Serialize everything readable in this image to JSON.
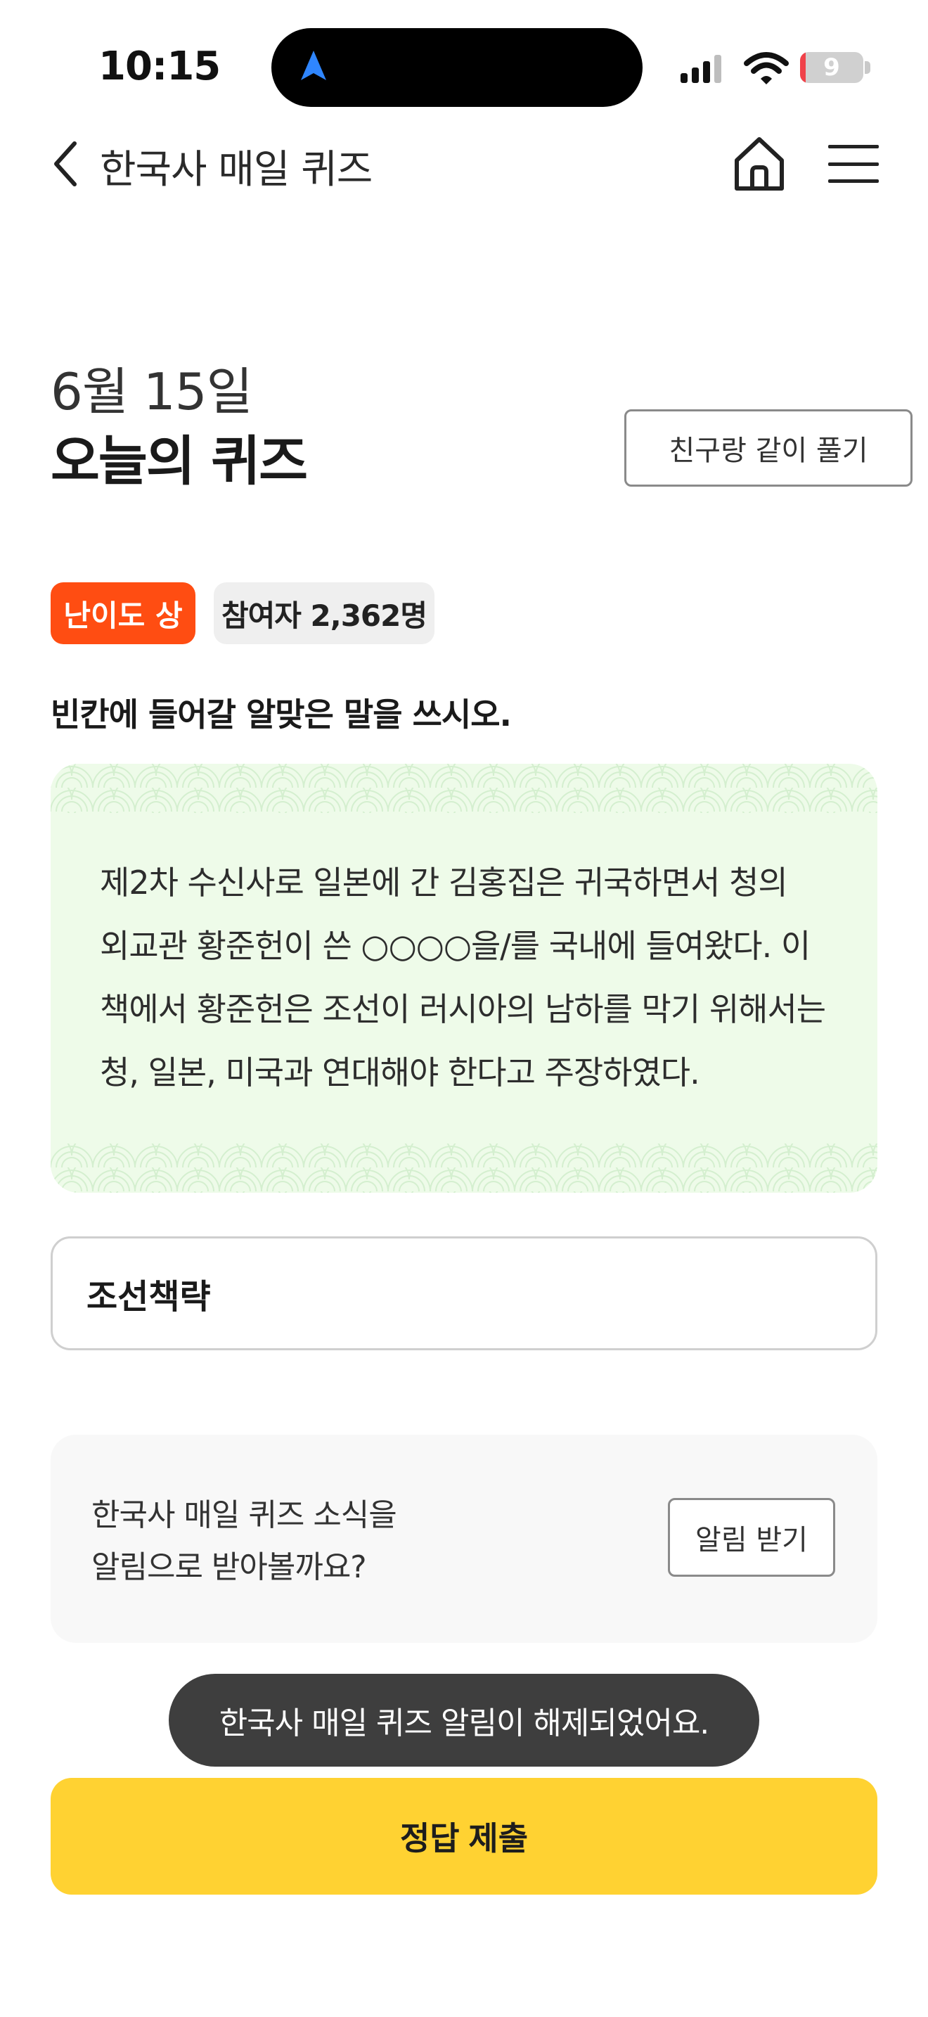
{
  "status_bar": {
    "time": "10:15",
    "battery_level": "9",
    "battery_fraction": 0.09
  },
  "nav": {
    "title": "한국사 매일 퀴즈"
  },
  "header": {
    "date": "6월 15일",
    "title": "오늘의 퀴즈",
    "friend_button": "친구랑 같이 풀기"
  },
  "badges": {
    "difficulty": "난이도 상",
    "participants": "참여자 2,362명"
  },
  "question": {
    "prompt": "빈칸에 들어갈 알맞은 말을 쓰시오.",
    "passage_lines": [
      "제2차 수신사로 일본에 간 김홍집은 귀국하면서 청의",
      "외교관 황준헌이 쓴 ○○○○을/를 국내에 들여왔다. 이",
      "책에서 황준헌은 조선이 러시아의 남하를 막기 위해서는",
      "청, 일본, 미국과 연대해야 한다고 주장하였다."
    ]
  },
  "answer": {
    "value": "조선책략"
  },
  "notify": {
    "line1": "한국사 매일 퀴즈 소식을",
    "line2": "알림으로 받아볼까요?",
    "button": "알림 받기"
  },
  "toast": {
    "message": "한국사 매일 퀴즈 알림이 해제되었어요."
  },
  "submit": {
    "label": "정답 제출"
  },
  "colors": {
    "difficulty_badge": "#ff4d12",
    "submit_button": "#ffd232",
    "passage_background": "#eefbe9"
  }
}
